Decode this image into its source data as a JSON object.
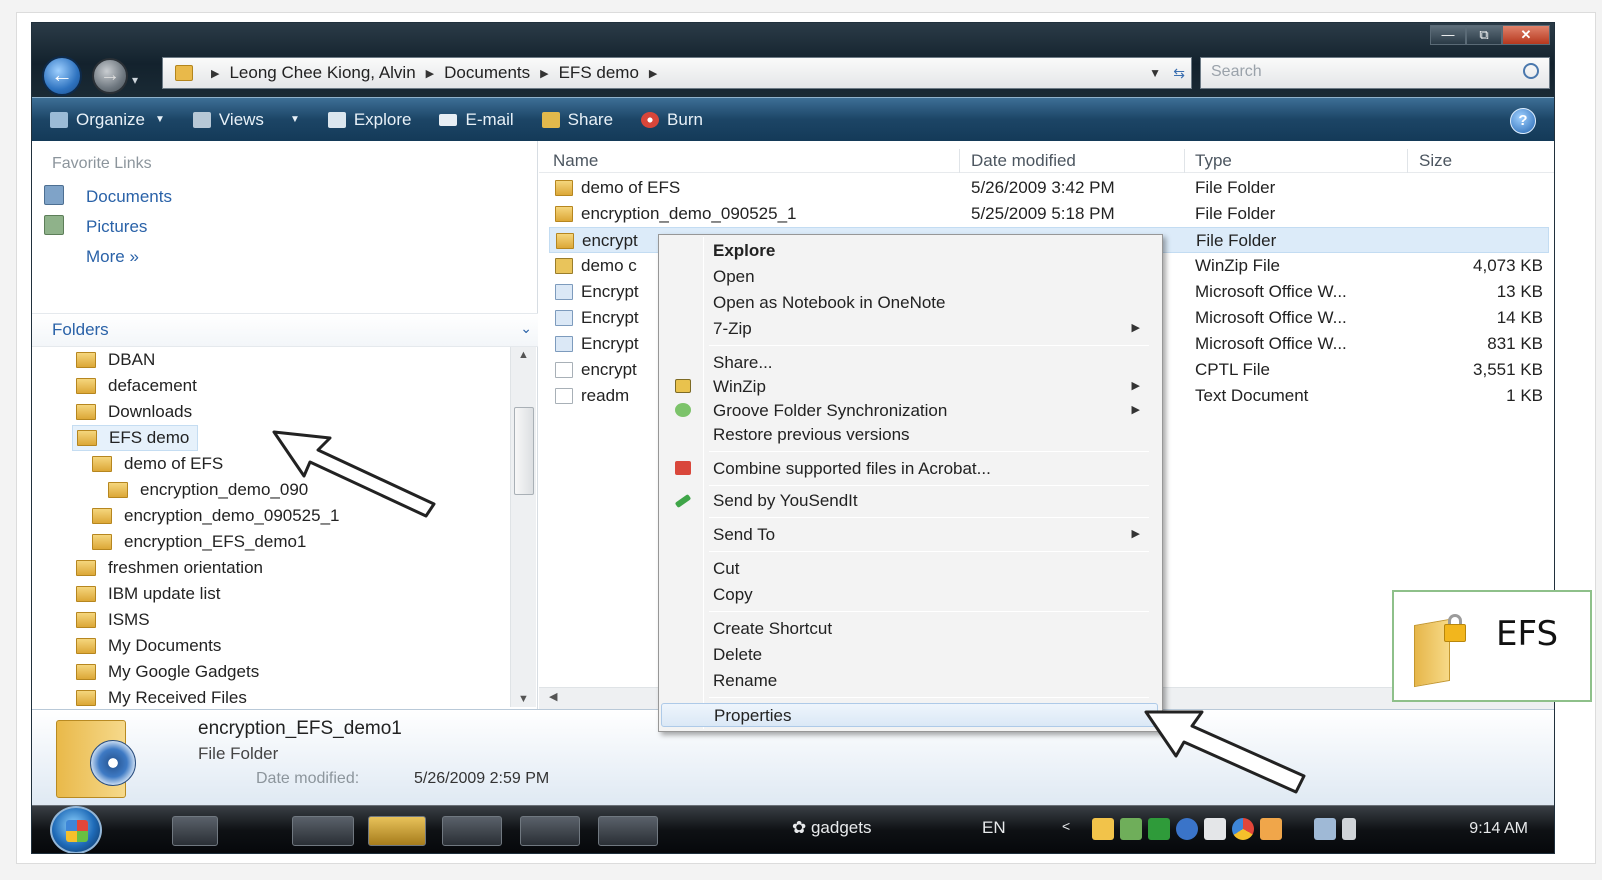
{
  "window": {
    "controls": {
      "minimize": "—",
      "maximize": "⧉",
      "close": "✕"
    }
  },
  "address": {
    "crumbs": [
      "Leong Chee Kiong, Alvin",
      "Documents",
      "EFS demo"
    ],
    "search_placeholder": "Search"
  },
  "toolbar": {
    "organize": "Organize",
    "views": "Views",
    "explore": "Explore",
    "email": "E-mail",
    "share": "Share",
    "burn": "Burn",
    "help": "?"
  },
  "favorites": {
    "header": "Favorite Links",
    "items": [
      "Documents",
      "Pictures",
      "More  »"
    ]
  },
  "folders": {
    "header": "Folders",
    "tree": [
      "DBAN",
      "defacement",
      "Downloads",
      "EFS demo",
      "demo of EFS",
      "encryption_demo_090",
      "encryption_demo_090525_1",
      "encryption_EFS_demo1",
      "freshmen orientation",
      "IBM update list",
      "ISMS",
      "My Documents",
      "My Google Gadgets",
      "My Received Files"
    ]
  },
  "filelist": {
    "columns": [
      "Name",
      "Date modified",
      "Type",
      "Size"
    ],
    "rows": [
      {
        "name": "demo of EFS",
        "date": "5/26/2009 3:42 PM",
        "type": "File Folder",
        "size": "",
        "icon": "folder-icon"
      },
      {
        "name": "encryption_demo_090525_1",
        "date": "5/25/2009 5:18 PM",
        "type": "File Folder",
        "size": "",
        "icon": "folder-icon"
      },
      {
        "name": "encrypt",
        "date": "",
        "type": "File Folder",
        "size": "",
        "icon": "folder-icon"
      },
      {
        "name": "demo c",
        "date": "",
        "type": "WinZip File",
        "size": "4,073 KB",
        "icon": "zip-icon"
      },
      {
        "name": "Encrypt",
        "date": "",
        "type": "Microsoft Office W...",
        "size": "13 KB",
        "icon": "word-doc-icon"
      },
      {
        "name": "Encrypt",
        "date": "",
        "type": "Microsoft Office W...",
        "size": "14 KB",
        "icon": "word-doc-icon"
      },
      {
        "name": "Encrypt",
        "date": "",
        "type": "Microsoft Office W...",
        "size": "831 KB",
        "icon": "word-doc-icon"
      },
      {
        "name": "encrypt",
        "date": "",
        "type": "CPTL File",
        "size": "3,551 KB",
        "icon": "file-icon"
      },
      {
        "name": "readm",
        "date": "",
        "type": "Text Document",
        "size": "1 KB",
        "icon": "text-file-icon"
      }
    ]
  },
  "context_menu": {
    "items": [
      "Explore",
      "Open",
      "Open as Notebook in OneNote",
      "7-Zip",
      "Share...",
      "WinZip",
      "Groove Folder Synchronization",
      "Restore previous versions",
      "Combine supported files in Acrobat...",
      "Send by YouSendIt",
      "Send To",
      "Cut",
      "Copy",
      "Create Shortcut",
      "Delete",
      "Rename",
      "Properties"
    ]
  },
  "details": {
    "name": "encryption_EFS_demo1",
    "type": "File Folder",
    "date_label": "Date modified:",
    "date": "5/26/2009 2:59 PM"
  },
  "taskbar": {
    "gadgets": "gadgets",
    "lang": "EN",
    "clock": "9:14 AM"
  },
  "callout": {
    "text": "EFS"
  },
  "colors": {
    "toolbar_blue": "#1c4566",
    "link_blue": "#2a62a8",
    "selection": "#dcebf9",
    "callout_border": "#8ec08a"
  }
}
